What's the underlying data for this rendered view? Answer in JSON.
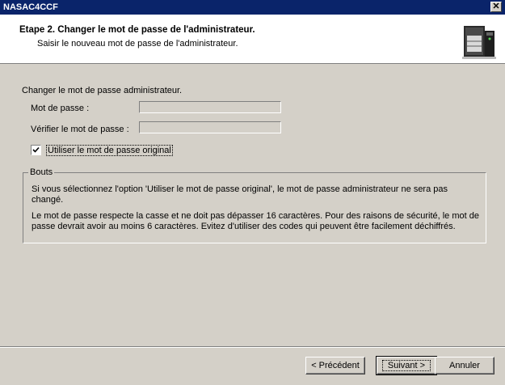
{
  "window": {
    "title": "NASAC4CCF",
    "close_symbol": "✕"
  },
  "header": {
    "step_title": "Etape 2. Changer le mot de passe de l'administrateur.",
    "step_subtitle": "Saisir le nouveau mot de passe de l'administrateur.",
    "icon": "server-icon"
  },
  "form": {
    "section_label": "Changer le mot de passe administrateur.",
    "password_label": "Mot de passe :",
    "password_value": "",
    "verify_label": "Vérifier le mot de passe :",
    "verify_value": "",
    "use_original_label": "Utiliser le mot de passe original",
    "use_original_checked": true
  },
  "tips": {
    "legend": "Bouts",
    "line1": "Si vous sélectionnez l'option 'Utiliser le mot de passe original', le mot de passe administrateur ne sera pas changé.",
    "line2": "Le mot de passe respecte la casse et ne doit pas dépasser 16 caractères. Pour des raisons de sécurité, le mot de passe devrait avoir au moins 6 caractères. Evitez d'utiliser des codes qui peuvent être facilement déchiffrés."
  },
  "buttons": {
    "back": "< Précédent",
    "next": "Suivant >",
    "cancel": "Annuler"
  }
}
